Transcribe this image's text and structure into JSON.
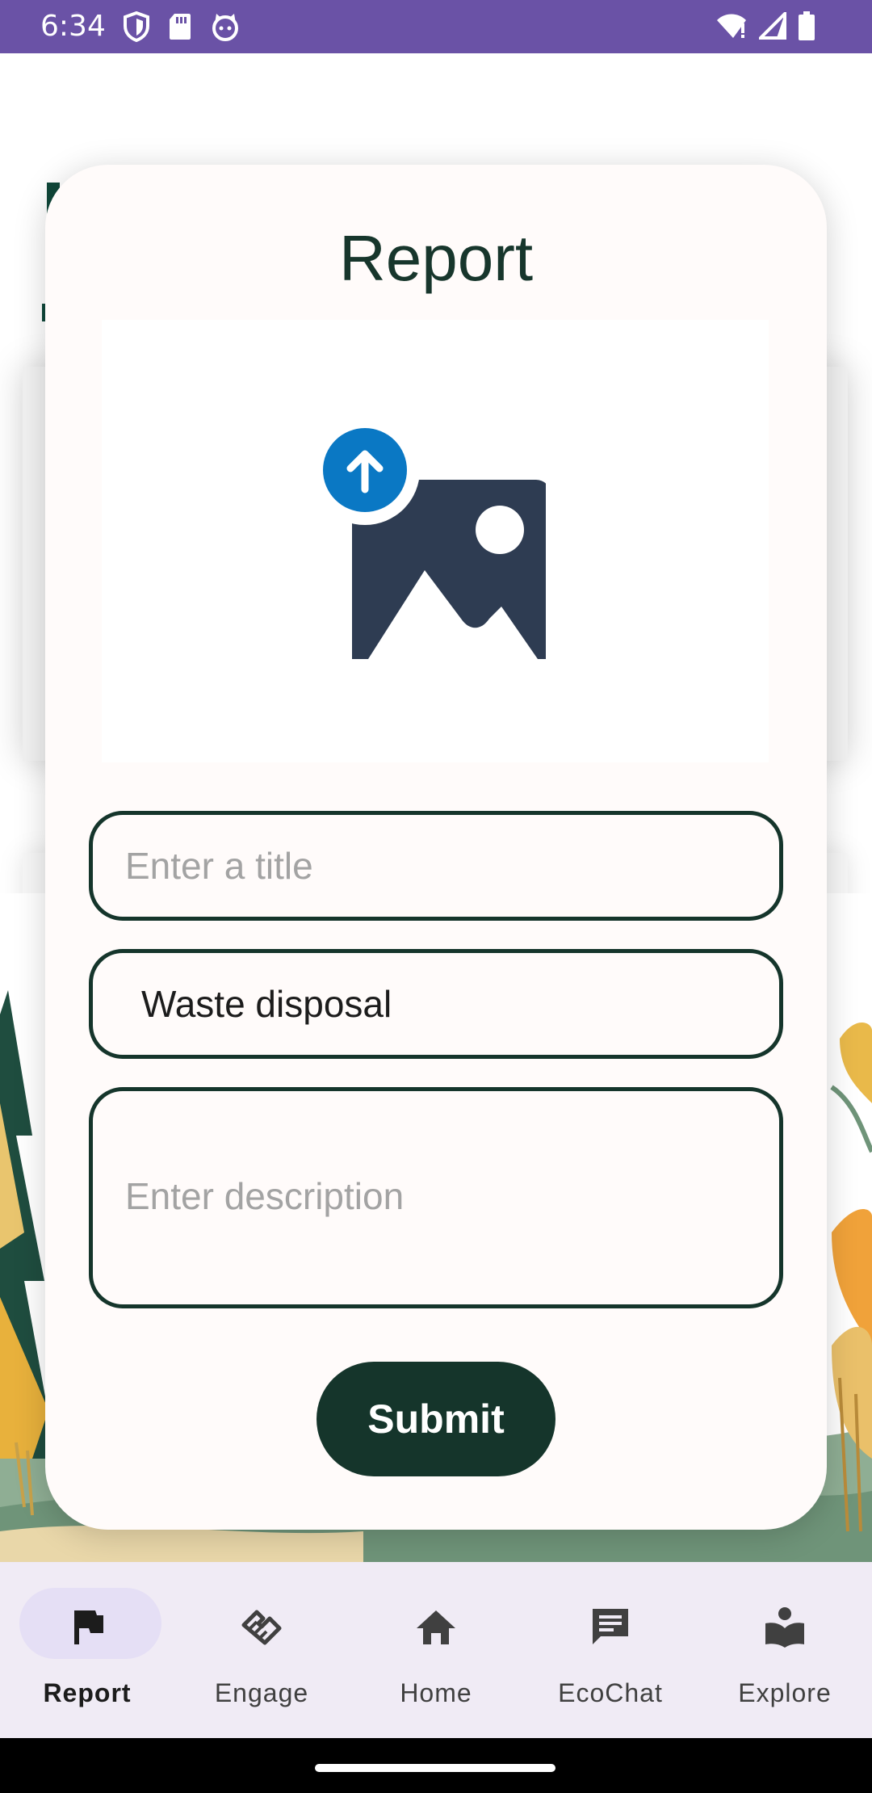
{
  "status_bar": {
    "time": "6:34",
    "icons_left": [
      "shield-icon",
      "sd-card-icon",
      "cat-face-icon"
    ],
    "icons_right": [
      "wifi-alert-icon",
      "signal-icon",
      "battery-icon"
    ],
    "color": "#6a52a6"
  },
  "dialog": {
    "title": "Report",
    "upload_icon": "image-upload-icon",
    "title_field": {
      "placeholder": "Enter a title",
      "value": ""
    },
    "category_field": {
      "value": "Waste disposal"
    },
    "description_field": {
      "placeholder": "Enter description",
      "value": ""
    },
    "submit_label": "Submit"
  },
  "bottom_nav": {
    "items": [
      {
        "label": "Report",
        "icon": "flag-icon",
        "active": true
      },
      {
        "label": "Engage",
        "icon": "handshake-icon",
        "active": false
      },
      {
        "label": "Home",
        "icon": "home-icon",
        "active": false
      },
      {
        "label": "EcoChat",
        "icon": "chat-icon",
        "active": false
      },
      {
        "label": "Explore",
        "icon": "book-reader-icon",
        "active": false
      }
    ]
  },
  "colors": {
    "primary_dark": "#15352b",
    "dialog_bg": "#fffbfa",
    "nav_bg": "#f0ebf5",
    "nav_active_pill": "#e5dff5",
    "upload_badge": "#0a78c4",
    "image_icon": "#2e3c52"
  }
}
